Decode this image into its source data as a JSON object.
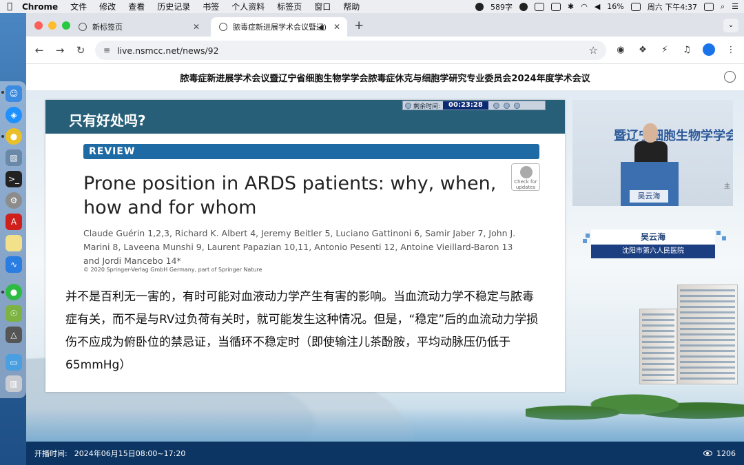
{
  "menubar": {
    "app": "Chrome",
    "items": [
      "文件",
      "修改",
      "查看",
      "历史记录",
      "书签",
      "个人资料",
      "标签页",
      "窗口",
      "帮助"
    ],
    "wechat_count": "589字",
    "battery": "16%",
    "clock": "周六 下午4:37"
  },
  "tabs": [
    {
      "title": "新标签页"
    },
    {
      "title": "脓毒症新进展学术会议暨辽"
    }
  ],
  "address": {
    "url": "live.nsmcc.net/news/92"
  },
  "page": {
    "header_title": "脓毒症新进展学术会议暨辽宁省细胞生物学学会脓毒症休克与细胞学研究专业委员会2024年度学术会议",
    "slide": {
      "heading": "只有好处吗?",
      "timer_label": "剩余时间:",
      "timer_value": "00:23:28",
      "review_label": "REVIEW",
      "check_badge": "Check for updates",
      "paper_title": "Prone position in ARDS patients: why, when, how and for whom",
      "authors": "Claude Guérin 1,2,3, Richard K. Albert 4, Jeremy Beitler 5, Luciano Gattinoni 6, Samir Jaber 7, John J. Marini 8, Laveena Munshi 9, Laurent Papazian 10,11, Antonio Pesenti 12, Antoine Vieillard-Baron 13 and Jordi Mancebo 14*",
      "copyright": "© 2020 Springer-Verlag GmbH Germany, part of Springer Nature",
      "body": "并不是百利无一害的，有时可能对血液动力学产生有害的影响。当血流动力学不稳定与脓毒症有关，而不是与RV过负荷有关时，就可能发生这种情况。但是，“稳定”后的血流动力学损伤不应成为俯卧位的禁忌证，当循环不稳定时（即使输注儿茶酚胺，平均动脉压仍低于 65mmHg）"
    },
    "speaker": {
      "banner_text": "暨辽宁细胞生物学学会",
      "podium_name": "吴云海",
      "side_text": "主",
      "name": "吴云海",
      "hospital": "沈阳市第六人民医院"
    },
    "footer": {
      "broadcast_label": "开播时间:",
      "broadcast_time": "2024年06月15日08:00~17:20",
      "views": "1206"
    }
  },
  "colors": {
    "slide_header": "#285f78",
    "review_blue": "#1d6aa5",
    "footer_navy": "#0d3563",
    "name_card_navy": "#1c3f82"
  }
}
